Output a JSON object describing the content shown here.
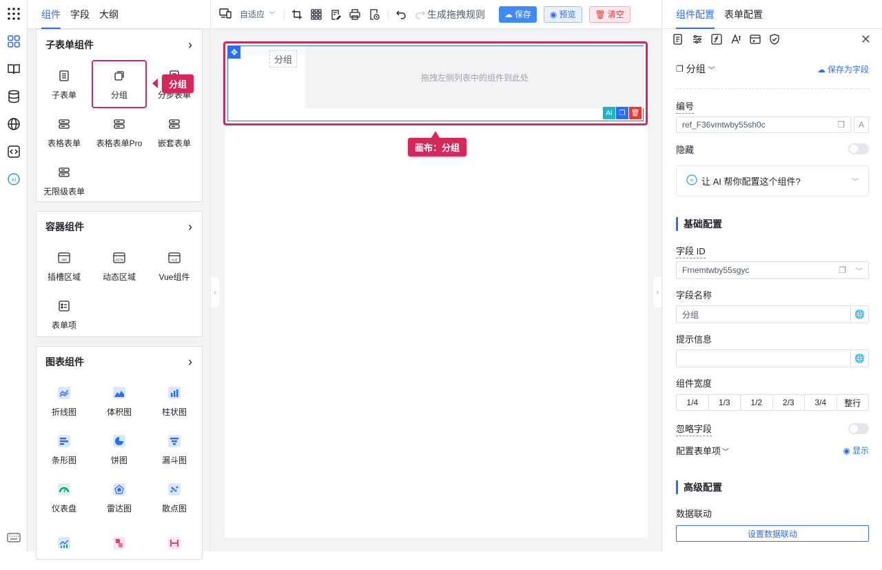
{
  "left_tabs": {
    "components": "组件",
    "fields": "字段",
    "outline": "大纲"
  },
  "groups": {
    "subform": {
      "title": "子表单组件",
      "items": [
        "子表单",
        "分组",
        "分步表单",
        "表格表单",
        "表格表单Pro",
        "嵌套表单",
        "无限级表单"
      ]
    },
    "container": {
      "title": "容器组件",
      "items": [
        "插槽区域",
        "动态区域",
        "Vue组件",
        "表单项"
      ]
    },
    "chart": {
      "title": "图表组件",
      "items": [
        "折线图",
        "体积图",
        "柱状图",
        "条形图",
        "饼图",
        "漏斗图",
        "仪表盘",
        "雷达图",
        "散点图"
      ]
    }
  },
  "callouts": {
    "group": "分组",
    "canvas": "画布：分组"
  },
  "toolbar": {
    "adaptive": "自适应",
    "gen_rules": "生成拖拽规则",
    "save": "保存",
    "preview": "预览",
    "clear": "清空"
  },
  "canvas": {
    "group_label": "分组",
    "drop_hint": "拖拽左侧列表中的组件到此处"
  },
  "right_tabs": {
    "component_config": "组件配置",
    "form_config": "表单配置"
  },
  "right": {
    "component_name": "分组",
    "save_as_field": "保存为字段",
    "id_label": "编号",
    "id_value": "ref_F36vmtwby55sh0c",
    "hidden_label": "隐藏",
    "ai_prompt": "让 AI 帮你配置这个组件?",
    "basic_section": "基础配置",
    "field_id_label": "字段 ID",
    "field_id_value": "Frnemtwby55sgyc",
    "field_name_label": "字段名称",
    "field_name_value": "分组",
    "tip_label": "提示信息",
    "tip_value": "",
    "width_label": "组件宽度",
    "widths": [
      "1/4",
      "1/3",
      "1/2",
      "2/3",
      "3/4",
      "整行"
    ],
    "ignore_label": "忽略字段",
    "form_item_label": "配置表单项",
    "show_label": "显示",
    "advanced_section": "高级配置",
    "linkage_label": "数据联动",
    "linkage_button": "设置数据联动"
  },
  "colors": {
    "accent": "#2d6cf6",
    "highlight": "#d4285a"
  }
}
